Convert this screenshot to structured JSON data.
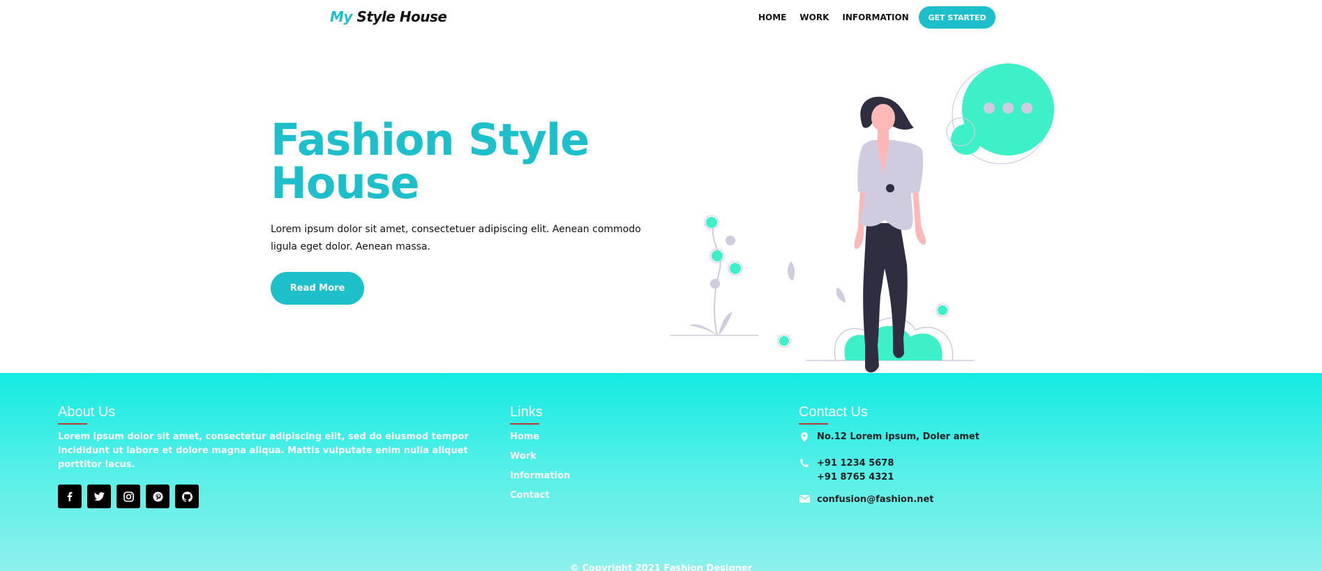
{
  "header": {
    "logo_part1": "My",
    "logo_part2": "Style House",
    "nav": [
      "HOME",
      "WORK",
      "INFORMATION"
    ],
    "cta": "GET STARTED"
  },
  "hero": {
    "title": "Fashion Style House",
    "text": "Lorem ipsum dolor sit amet, consectetuer adipiscing elit. Aenean commodo ligula eget dolor. Aenean massa.",
    "button": "Read More"
  },
  "footer": {
    "about": {
      "title": "About Us",
      "text": "Lorem ipsum dolor sit amet, consectetur adipiscing elit, sed do eiusmod tempor incididunt ut labore et dolore magna aliqua. Mattis vulputate enim nulla aliquet porttitor lacus.",
      "socials": [
        "facebook-icon",
        "twitter-icon",
        "instagram-icon",
        "pinterest-icon",
        "github-icon"
      ]
    },
    "links": {
      "title": "Links",
      "items": [
        "Home",
        "Work",
        "Information",
        "Contact"
      ]
    },
    "contact": {
      "title": "Contact Us",
      "address": "No.12 Lorem ipsum, Doler amet",
      "phone1": "+91 1234 5678",
      "phone2": "+91 8765 4321",
      "email": "confusion@fashion.net"
    },
    "copyright": "© Copyright 2021 Fashion Designer"
  },
  "colors": {
    "accent": "#1dbfcb",
    "footer_top": "#14ebe2",
    "bubble": "#3ef0c8",
    "figure_dark": "#2f2e41",
    "jacket": "#cfcce0",
    "skin": "#ffb8b8"
  }
}
